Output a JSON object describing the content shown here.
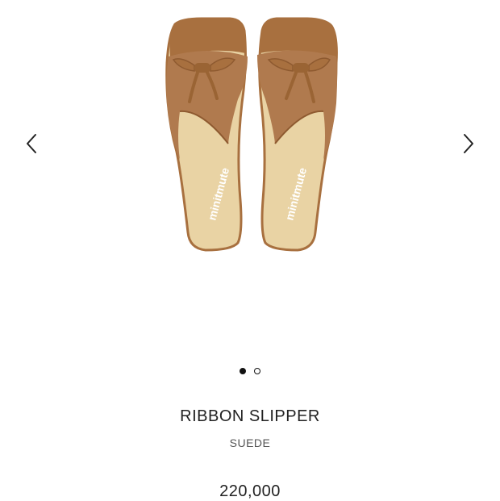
{
  "gallery": {
    "prev_icon": "chevron-left-icon",
    "next_icon": "chevron-right-icon",
    "brand_imprint": "minitmute",
    "slide_count": 2,
    "active_slide": 1
  },
  "product": {
    "name": "RIBBON SLIPPER",
    "variant": "SUEDE",
    "price": "220,000"
  },
  "colors": {
    "suede": "#B07A4E",
    "leather_trim": "#A8703F",
    "footbed": "#E9D3A4",
    "text": "#222222"
  }
}
